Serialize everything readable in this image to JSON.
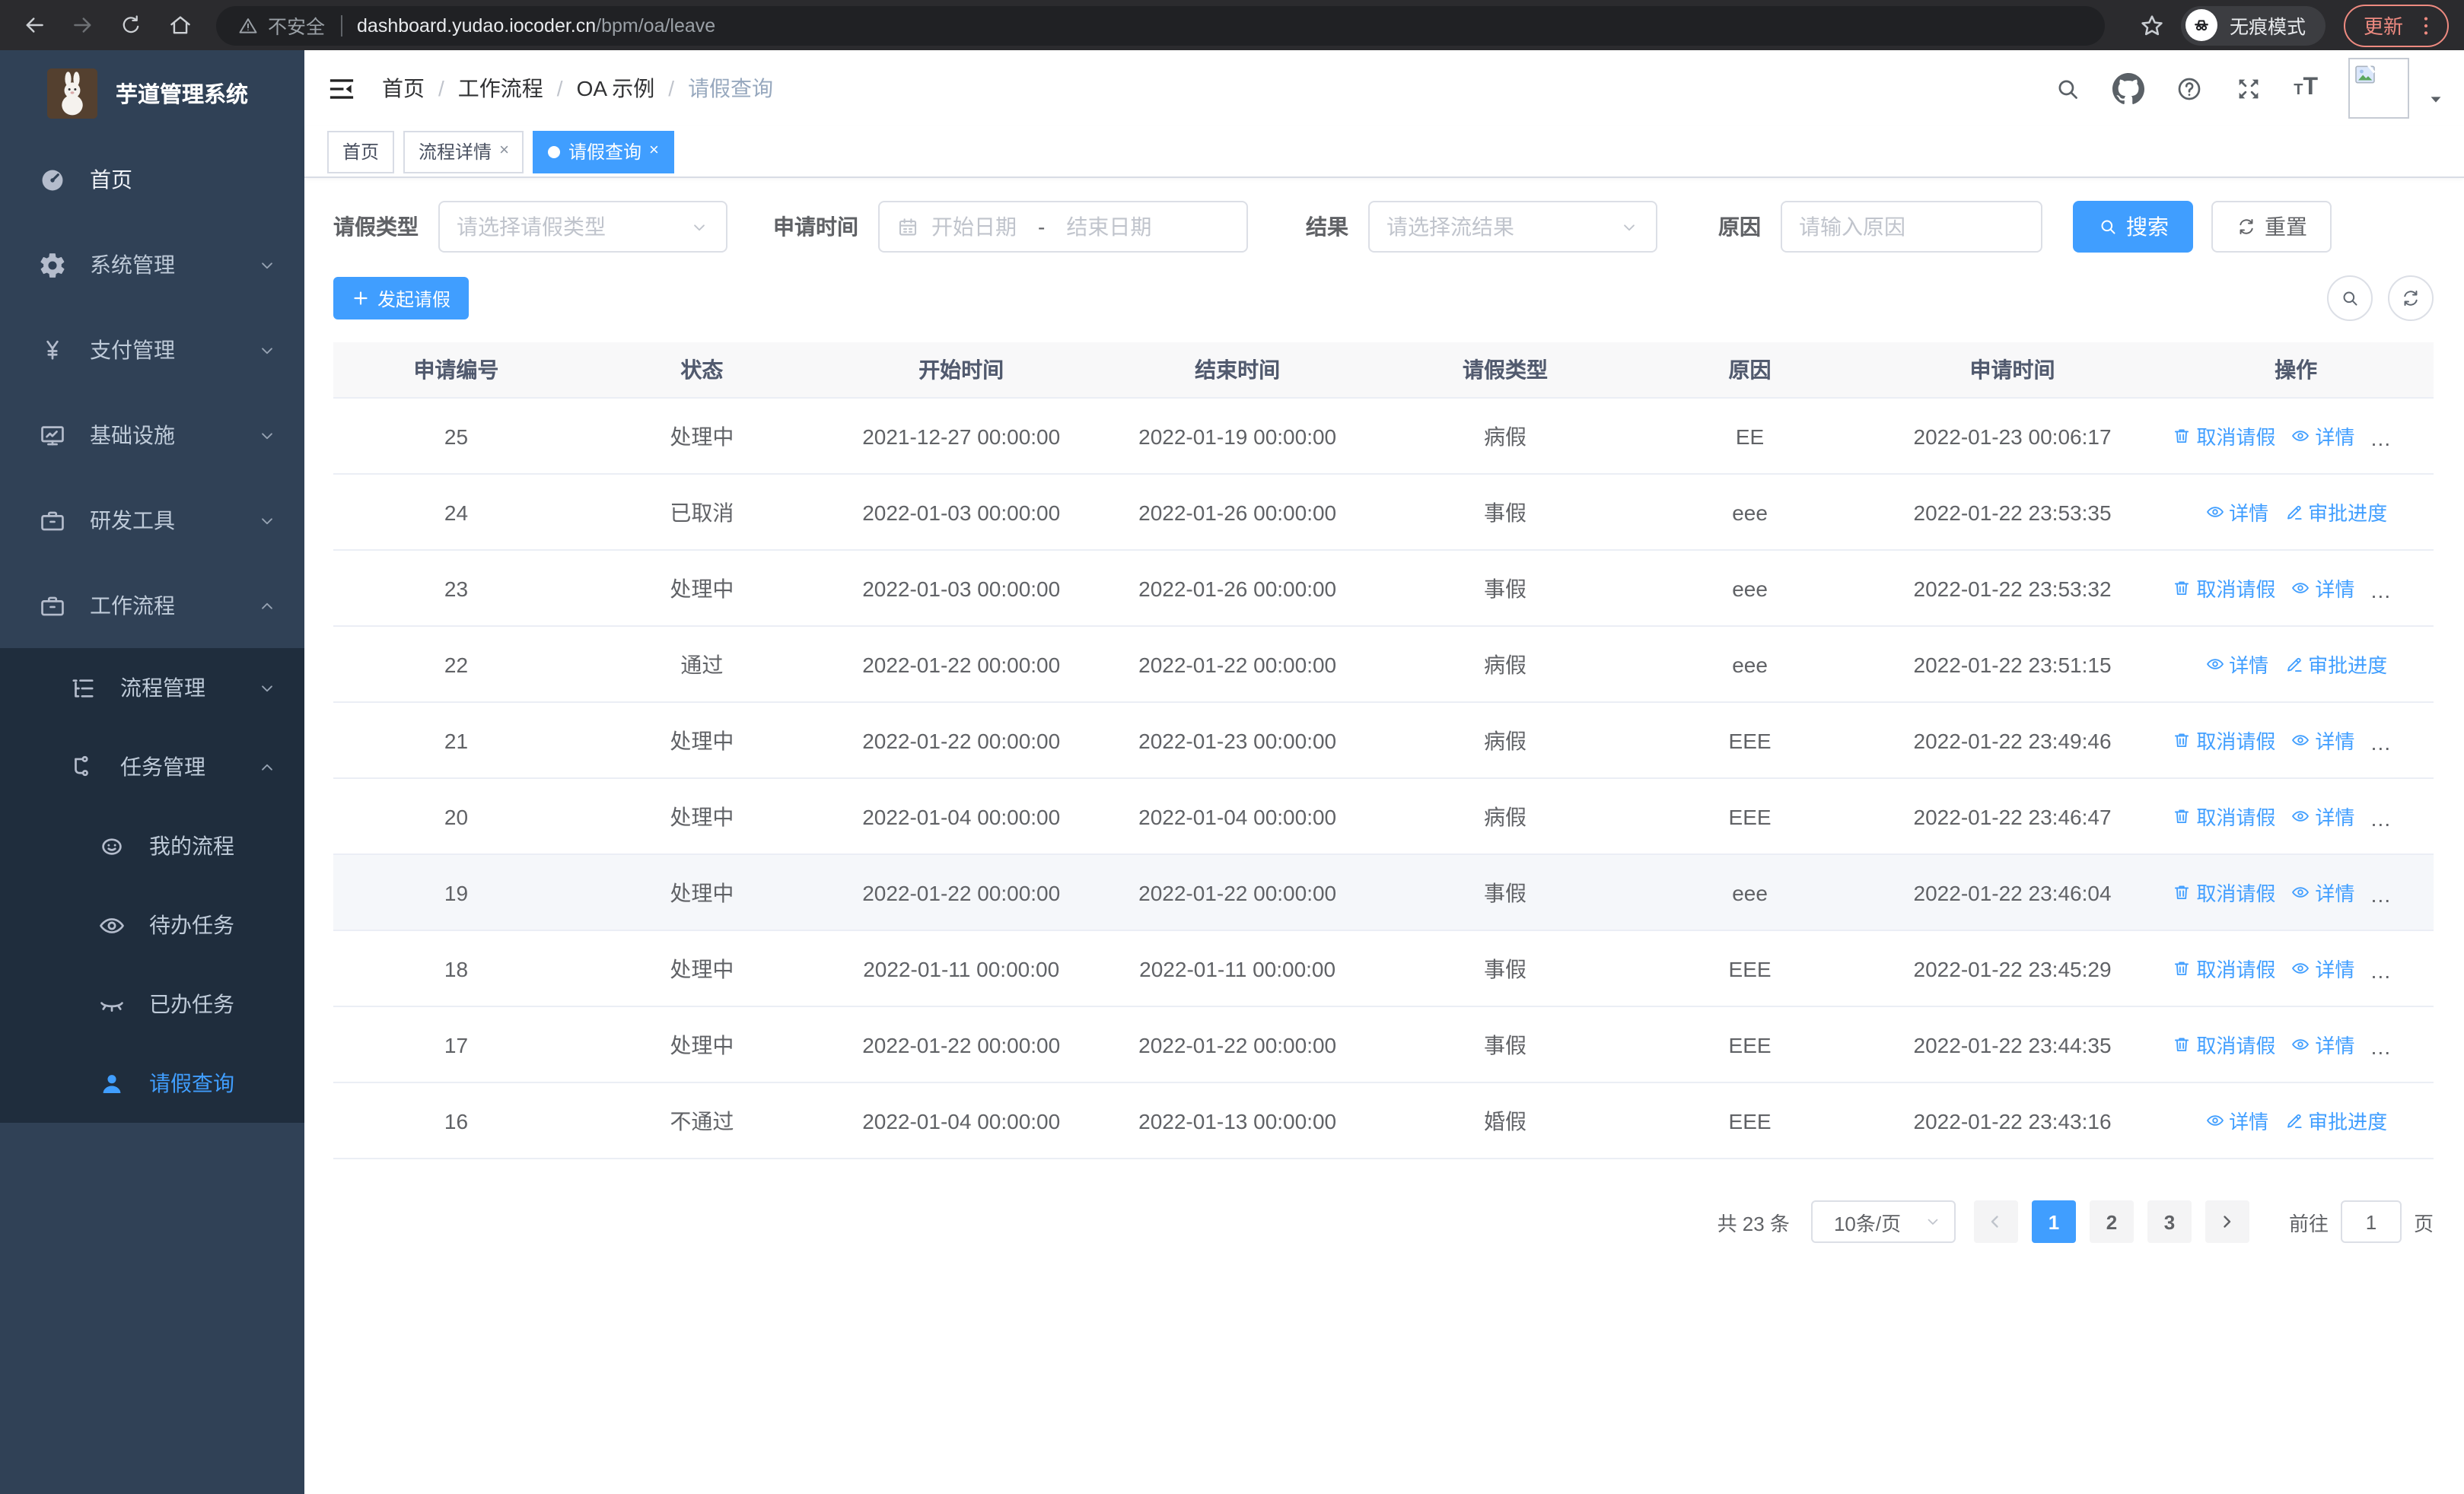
{
  "browser": {
    "security_label": "不安全",
    "url_host": "dashboard.yudao.iocoder.cn",
    "url_path": "/bpm/oa/leave",
    "incognito_label": "无痕模式",
    "update_label": "更新"
  },
  "sidebar": {
    "title": "芋道管理系统",
    "items": [
      {
        "label": "首页",
        "icon": "dashboard"
      },
      {
        "label": "系统管理",
        "icon": "gear",
        "chevron": "down"
      },
      {
        "label": "支付管理",
        "icon": "yen",
        "chevron": "down"
      },
      {
        "label": "基础设施",
        "icon": "monitor",
        "chevron": "down"
      },
      {
        "label": "研发工具",
        "icon": "briefcase",
        "chevron": "down"
      },
      {
        "label": "工作流程",
        "icon": "briefcase",
        "chevron": "up"
      }
    ],
    "submenu": [
      {
        "label": "流程管理",
        "icon": "list-tree",
        "chevron": "down"
      },
      {
        "label": "任务管理",
        "icon": "flow",
        "chevron": "up"
      },
      {
        "label": "我的流程",
        "icon": "face"
      },
      {
        "label": "待办任务",
        "icon": "eye"
      },
      {
        "label": "已办任务",
        "icon": "eye-closed"
      },
      {
        "label": "请假查询",
        "icon": "user",
        "active": true
      }
    ]
  },
  "header": {
    "breadcrumb": [
      "首页",
      "工作流程",
      "OA 示例",
      "请假查询"
    ],
    "separator": "/"
  },
  "tabs": [
    {
      "label": "首页",
      "closable": false,
      "active": false
    },
    {
      "label": "流程详情",
      "closable": true,
      "active": false
    },
    {
      "label": "请假查询",
      "closable": true,
      "active": true
    }
  ],
  "filters": {
    "leave_type_label": "请假类型",
    "leave_type_placeholder": "请选择请假类型",
    "apply_time_label": "申请时间",
    "start_date_placeholder": "开始日期",
    "range_separator": "-",
    "end_date_placeholder": "结束日期",
    "result_label": "结果",
    "result_placeholder": "请选择流结果",
    "reason_label": "原因",
    "reason_placeholder": "请输入原因",
    "search_label": "搜索",
    "reset_label": "重置"
  },
  "toolbar": {
    "create_label": "发起请假"
  },
  "table": {
    "columns": [
      "申请编号",
      "状态",
      "开始时间",
      "结束时间",
      "请假类型",
      "原因",
      "申请时间",
      "操作"
    ],
    "action_labels": {
      "cancel": "取消请假",
      "detail": "详情",
      "progress": "审批进度"
    },
    "rows": [
      {
        "id": "25",
        "status": "处理中",
        "start": "2021-12-27 00:00:00",
        "end": "2022-01-19 00:00:00",
        "type": "病假",
        "reason": "EE",
        "applied": "2022-01-23 00:06:17",
        "actions": [
          "cancel",
          "detail",
          "progress"
        ]
      },
      {
        "id": "24",
        "status": "已取消",
        "start": "2022-01-03 00:00:00",
        "end": "2022-01-26 00:00:00",
        "type": "事假",
        "reason": "eee",
        "applied": "2022-01-22 23:53:35",
        "actions": [
          "detail",
          "progress"
        ]
      },
      {
        "id": "23",
        "status": "处理中",
        "start": "2022-01-03 00:00:00",
        "end": "2022-01-26 00:00:00",
        "type": "事假",
        "reason": "eee",
        "applied": "2022-01-22 23:53:32",
        "actions": [
          "cancel",
          "detail",
          "progress"
        ]
      },
      {
        "id": "22",
        "status": "通过",
        "start": "2022-01-22 00:00:00",
        "end": "2022-01-22 00:00:00",
        "type": "病假",
        "reason": "eee",
        "applied": "2022-01-22 23:51:15",
        "actions": [
          "detail",
          "progress"
        ]
      },
      {
        "id": "21",
        "status": "处理中",
        "start": "2022-01-22 00:00:00",
        "end": "2022-01-23 00:00:00",
        "type": "病假",
        "reason": "EEE",
        "applied": "2022-01-22 23:49:46",
        "actions": [
          "cancel",
          "detail",
          "progress"
        ]
      },
      {
        "id": "20",
        "status": "处理中",
        "start": "2022-01-04 00:00:00",
        "end": "2022-01-04 00:00:00",
        "type": "病假",
        "reason": "EEE",
        "applied": "2022-01-22 23:46:47",
        "actions": [
          "cancel",
          "detail",
          "progress"
        ]
      },
      {
        "id": "19",
        "status": "处理中",
        "start": "2022-01-22 00:00:00",
        "end": "2022-01-22 00:00:00",
        "type": "事假",
        "reason": "eee",
        "applied": "2022-01-22 23:46:04",
        "actions": [
          "cancel",
          "detail",
          "progress"
        ],
        "highlight": true
      },
      {
        "id": "18",
        "status": "处理中",
        "start": "2022-01-11 00:00:00",
        "end": "2022-01-11 00:00:00",
        "type": "事假",
        "reason": "EEE",
        "applied": "2022-01-22 23:45:29",
        "actions": [
          "cancel",
          "detail",
          "progress"
        ]
      },
      {
        "id": "17",
        "status": "处理中",
        "start": "2022-01-22 00:00:00",
        "end": "2022-01-22 00:00:00",
        "type": "事假",
        "reason": "EEE",
        "applied": "2022-01-22 23:44:35",
        "actions": [
          "cancel",
          "detail",
          "progress"
        ]
      },
      {
        "id": "16",
        "status": "不通过",
        "start": "2022-01-04 00:00:00",
        "end": "2022-01-13 00:00:00",
        "type": "婚假",
        "reason": "EEE",
        "applied": "2022-01-22 23:43:16",
        "actions": [
          "detail",
          "progress"
        ]
      }
    ]
  },
  "pagination": {
    "total_label": "共 23 条",
    "page_size": "10条/页",
    "pages": [
      "1",
      "2",
      "3"
    ],
    "active_page": "1",
    "goto_label": "前往",
    "goto_value": "1",
    "page_label": "页"
  },
  "colors": {
    "primary": "#409eff",
    "sidebar_bg": "#304156",
    "submenu_bg": "#1f2d3d",
    "table_header_bg": "#f8f8f9",
    "row_highlight": "#f5f7fa",
    "update_badge": "#ee8a80",
    "chrome_bar": "#2b2b2e"
  }
}
